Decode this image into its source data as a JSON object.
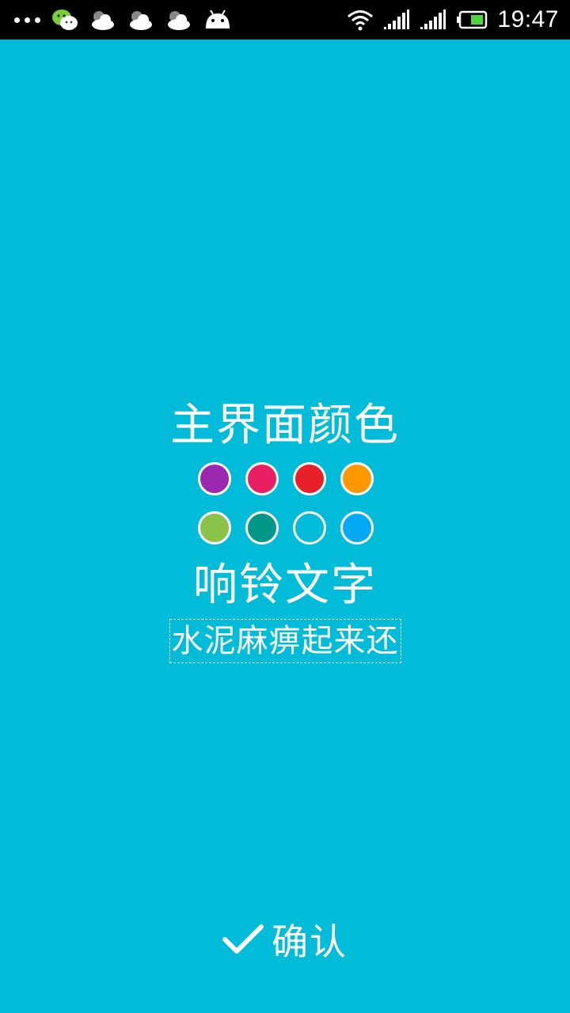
{
  "status_bar": {
    "time": "19:47",
    "icons": [
      "more-dots-icon",
      "wechat-icon",
      "weather-cloudy-icon",
      "weather-cloudy-icon",
      "weather-cloudy-icon",
      "android-icon",
      "wifi-icon",
      "signal-icon",
      "signal-icon",
      "battery-icon"
    ]
  },
  "theme_section": {
    "title": "主界面颜色",
    "colors": [
      "#9c27b0",
      "#e91e63",
      "#e8202a",
      "#ff9800",
      "#8bc34a",
      "#009688",
      "#00bcd8",
      "#03a9f4"
    ]
  },
  "ring_section": {
    "title": "响铃文字",
    "text_value": "水泥麻痹起来还"
  },
  "confirm": {
    "label": "确认"
  },
  "colors": {
    "background": "#00bcd8",
    "status_bar": "#000000",
    "foreground": "#ffffff"
  }
}
